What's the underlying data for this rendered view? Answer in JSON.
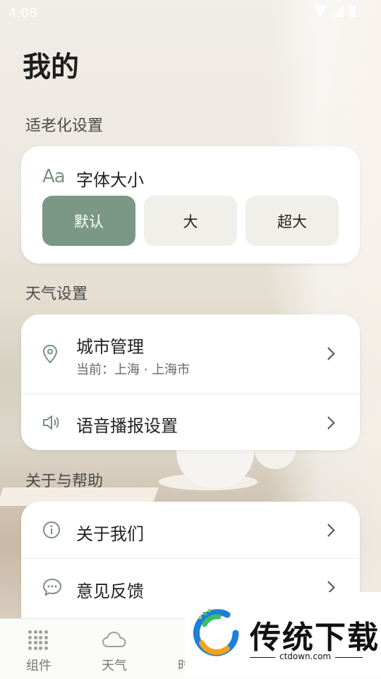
{
  "status_bar": {
    "time": "4:08"
  },
  "page_title": "我的",
  "sections": {
    "elder": "适老化设置",
    "weather": "天气设置",
    "about": "关于与帮助"
  },
  "font_size": {
    "icon_text": "Aa",
    "label": "字体大小",
    "options": [
      "默认",
      "大",
      "超大"
    ],
    "selected": "默认"
  },
  "weather_rows": {
    "city": {
      "title": "城市管理",
      "subtitle": "当前：上海 · 上海市",
      "icon": "location-pin-icon"
    },
    "voice": {
      "title": "语音播报设置",
      "icon": "speaker-icon"
    }
  },
  "about_rows": {
    "about_us": {
      "title": "关于我们",
      "icon": "info-icon"
    },
    "feedback": {
      "title": "意见反馈",
      "icon": "chat-bubble-icon"
    }
  },
  "tabs": [
    "组件",
    "天气",
    "时"
  ],
  "watermark": {
    "text": "传统下载",
    "url": "ctdown.com"
  },
  "colors": {
    "accent": "#7a9885",
    "background": "#ece7df",
    "card": "#ffffff"
  }
}
